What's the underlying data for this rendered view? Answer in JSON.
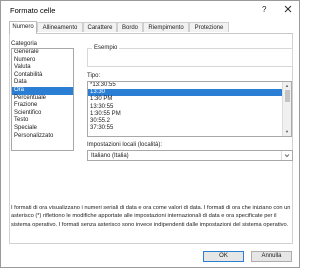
{
  "window": {
    "title": "Formato celle",
    "help_glyph": "?"
  },
  "tabs": [
    {
      "label": "Numero",
      "active": true
    },
    {
      "label": "Allineamento"
    },
    {
      "label": "Carattere"
    },
    {
      "label": "Bordo"
    },
    {
      "label": "Riempimento"
    },
    {
      "label": "Protezione"
    }
  ],
  "category": {
    "label": "Categoria",
    "items": [
      "Generale",
      "Numero",
      "Valuta",
      "Contabilità",
      "Data",
      "Ora",
      "Percentuale",
      "Frazione",
      "Scientifico",
      "Testo",
      "Speciale",
      "Personalizzato"
    ],
    "selected": "Ora"
  },
  "example": {
    "label": "Esempio"
  },
  "type": {
    "label": "Tipo:",
    "items": [
      "*13:30:55",
      "13:30",
      "1:30 PM",
      "13:30:55",
      "1:30:55 PM",
      "30:55.2",
      "37:30:55"
    ],
    "selected_index": 1
  },
  "locale": {
    "label": "Impostazioni locali (località):",
    "value": "Italiano (Italia)"
  },
  "description": "I formati di ora visualizzano i numeri seriali di data e ora come valori di data. I formati di ora che iniziano con un asterisco (*) riflettono le modifiche apportate alle impostazioni internazionali di data e ora specificate per il sistema operativo. I formati senza asterisco sono invece indipendenti dalle impostazioni del sistema operativo.",
  "buttons": {
    "ok": "OK",
    "cancel": "Annulla"
  },
  "colors": {
    "selection": "#2a7fd4"
  }
}
